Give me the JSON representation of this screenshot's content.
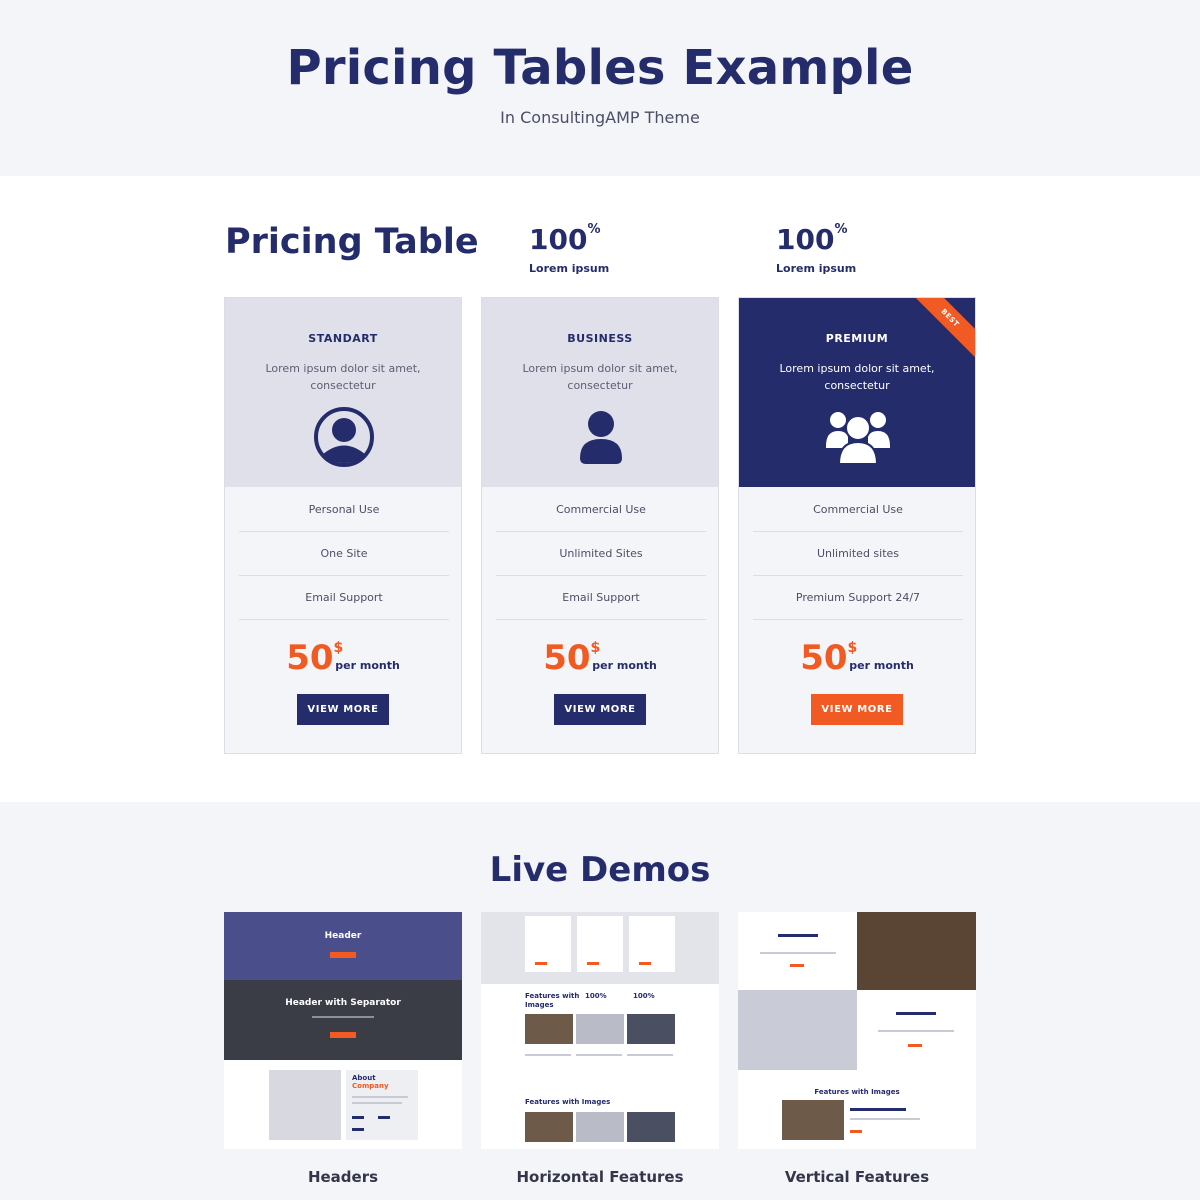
{
  "hero": {
    "title": "Pricing Tables Example",
    "subtitle": "In ConsultingAMP Theme"
  },
  "pricing": {
    "heading": "Pricing Table",
    "stats": [
      {
        "value": "100",
        "unit": "%",
        "label": "Lorem ipsum"
      },
      {
        "value": "100",
        "unit": "%",
        "label": "Lorem ipsum"
      }
    ],
    "plans": [
      {
        "name": "STANDART",
        "description": "Lorem ipsum dolor sit amet, consectetur",
        "icon": "user-circle-icon",
        "features": [
          "Personal Use",
          "One Site",
          "Email Support"
        ],
        "price": "50",
        "currency": "$",
        "period": "per month",
        "button": "VIEW MORE"
      },
      {
        "name": "BUSINESS",
        "description": "Lorem ipsum dolor sit amet, consectetur",
        "icon": "user-icon",
        "features": [
          "Commercial Use",
          "Unlimited Sites",
          "Email Support"
        ],
        "price": "50",
        "currency": "$",
        "period": "per month",
        "button": "VIEW MORE"
      },
      {
        "name": "PREMIUM",
        "description": "Lorem ipsum dolor sit amet, consectetur",
        "icon": "users-group-icon",
        "badge": "BEST",
        "features": [
          "Commercial Use",
          "Unlimited sites",
          "Premium Support 24/7"
        ],
        "price": "50",
        "currency": "$",
        "period": "per month",
        "button": "VIEW MORE"
      }
    ],
    "colors": {
      "navy": "#252c6b",
      "orange": "#f15a22",
      "light": "#dfe0ea"
    }
  },
  "demos": {
    "title": "Live Demos",
    "items": [
      {
        "label": "Headers",
        "thumb": {
          "header": "Header",
          "separator": "Header with Separator",
          "about_1": "About",
          "about_2": "Company"
        }
      },
      {
        "label": "Horizontal Features",
        "thumb": {
          "section_1": "Features with Images",
          "section_2": "Features with Images",
          "stat": "100%"
        }
      },
      {
        "label": "Vertical Features",
        "thumb": {
          "section": "Features with Images"
        }
      }
    ]
  }
}
